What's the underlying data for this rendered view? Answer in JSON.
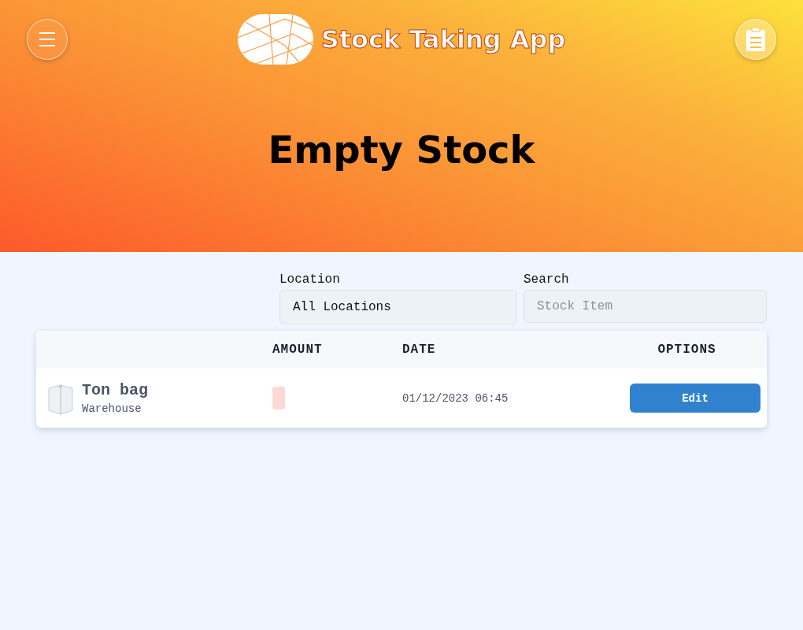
{
  "header": {
    "app_title": "Stock Taking App",
    "page_title": "Empty Stock"
  },
  "filters": {
    "location": {
      "label": "Location",
      "value": "All Locations"
    },
    "search": {
      "label": "Search",
      "placeholder": "Stock Item"
    }
  },
  "table": {
    "columns": [
      "AMOUNT",
      "DATE",
      "OPTIONS"
    ],
    "rows": [
      {
        "name": "Ton bag",
        "location": "Warehouse",
        "date": "01/12/2023 06:45",
        "action": "Edit"
      }
    ]
  }
}
